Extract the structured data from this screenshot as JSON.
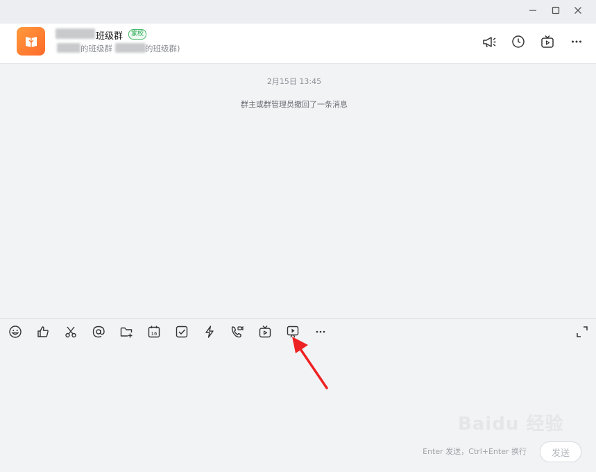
{
  "header": {
    "title": "班级群",
    "badge": "家校",
    "subtitle_part1": "的班级群",
    "subtitle_part2": "的班级群)"
  },
  "chat": {
    "timestamp": "2月15日 13:45",
    "system_message": "群主或群管理员撤回了一条消息"
  },
  "toolbar": {
    "calendar_day": "16"
  },
  "input": {
    "hint": "Enter 发送，Ctrl+Enter 换行",
    "send_label": "发送"
  },
  "watermark": "Baidu 经验",
  "colors": {
    "avatar": "#ff8a30",
    "badge": "#1aa34a",
    "arrow": "#ee2222"
  }
}
